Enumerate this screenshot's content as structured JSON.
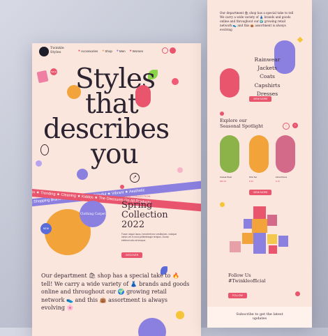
{
  "nav": {
    "logo_text": "Twinkle Styles",
    "items": [
      "Accessories",
      "Shop",
      "Men",
      "Women"
    ]
  },
  "hero": {
    "line1": "Styles",
    "line2": "that",
    "line3": "describes",
    "line4": "you",
    "badge": "SALE"
  },
  "ribbons": {
    "top": "Sale ★ Best Shopping Brand Around Europe ★ Colorful ★ Vibrant ★ Aesthetic",
    "bottom": "tion ★ Unisex ★ Trending ★ Cleaning ★ Kiddos ★ The Discounts On All Products"
  },
  "spring": {
    "tag": "LATEST COLLECTION",
    "title": "Spring Collection 2022",
    "body": "Fusce neque lacus, hendrerit nec vestibulum, volutpat varius vel in nunc pellentesque tempus. Donec eleifend odio at tempus.",
    "button": "DISCOVER",
    "bubble": "Clothing Carpet",
    "badge": "NEW"
  },
  "about": {
    "text": "Our department 🛍 shop has a special take to 🔥 tell! We carry a wide variety of 👗 brands and goods online and throughout our 🌍 growing retail network 👟 and this 👜 assortment is always evolving 🌸"
  },
  "side": {
    "top_text": "Our department 🛍 shop has a special take to tell We carry a wide variety of 👗 brands and goods online and throughout our 🌍 growing retail network 👟 and this 👜 assortment is always evolving",
    "categories": [
      "Rainwear",
      "Jackets",
      "Coats",
      "Capshirts",
      "Dresses"
    ],
    "button": "VIEW MORE",
    "spotlight_title": "Explore our Seasonal Spotlight",
    "products": [
      {
        "name": "Casual Wear",
        "price": "$89.00"
      },
      {
        "name": "Pink Set",
        "price": "$ 99"
      },
      {
        "name": "Floral Dress",
        "price": "$ 45"
      }
    ],
    "follow_title": "Follow Us #Twinkleofficial",
    "follow_button": "FOLLOW",
    "subscribe_title": "Subscribe to get the latest updates"
  },
  "colors": {
    "page_bg": "#fbe6dd",
    "accent": "#e8556c",
    "purple": "#8b7fe0",
    "orange": "#f2a33a",
    "text": "#3a2b38"
  }
}
